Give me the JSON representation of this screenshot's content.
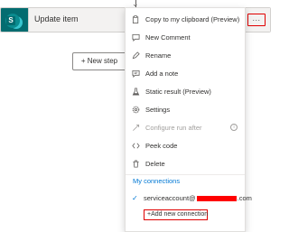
{
  "action": {
    "title": "Update item",
    "logo_letter": "S",
    "more_label": "..."
  },
  "new_step_label": "+ New step",
  "menu": {
    "items": [
      {
        "label": "Copy to my clipboard (Preview)",
        "icon": "clipboard-icon",
        "disabled": false
      },
      {
        "label": "New Comment",
        "icon": "comment-icon",
        "disabled": false
      },
      {
        "label": "Rename",
        "icon": "pencil-icon",
        "disabled": false
      },
      {
        "label": "Add a note",
        "icon": "note-icon",
        "disabled": false
      },
      {
        "label": "Static result (Preview)",
        "icon": "beaker-icon",
        "disabled": false
      },
      {
        "label": "Settings",
        "icon": "gear-icon",
        "disabled": false
      },
      {
        "label": "Configure run after",
        "icon": "link-icon",
        "disabled": true
      },
      {
        "label": "Peek code",
        "icon": "code-icon",
        "disabled": false
      },
      {
        "label": "Delete",
        "icon": "trash-icon",
        "disabled": false
      }
    ],
    "connections_header": "My connections",
    "connection": {
      "prefix": "serviceaccount@",
      "suffix": ".com"
    },
    "add_connection_label": "+Add new connection"
  },
  "colors": {
    "brand": "#036c70",
    "accent": "#0078d4",
    "highlight": "#e00000"
  }
}
